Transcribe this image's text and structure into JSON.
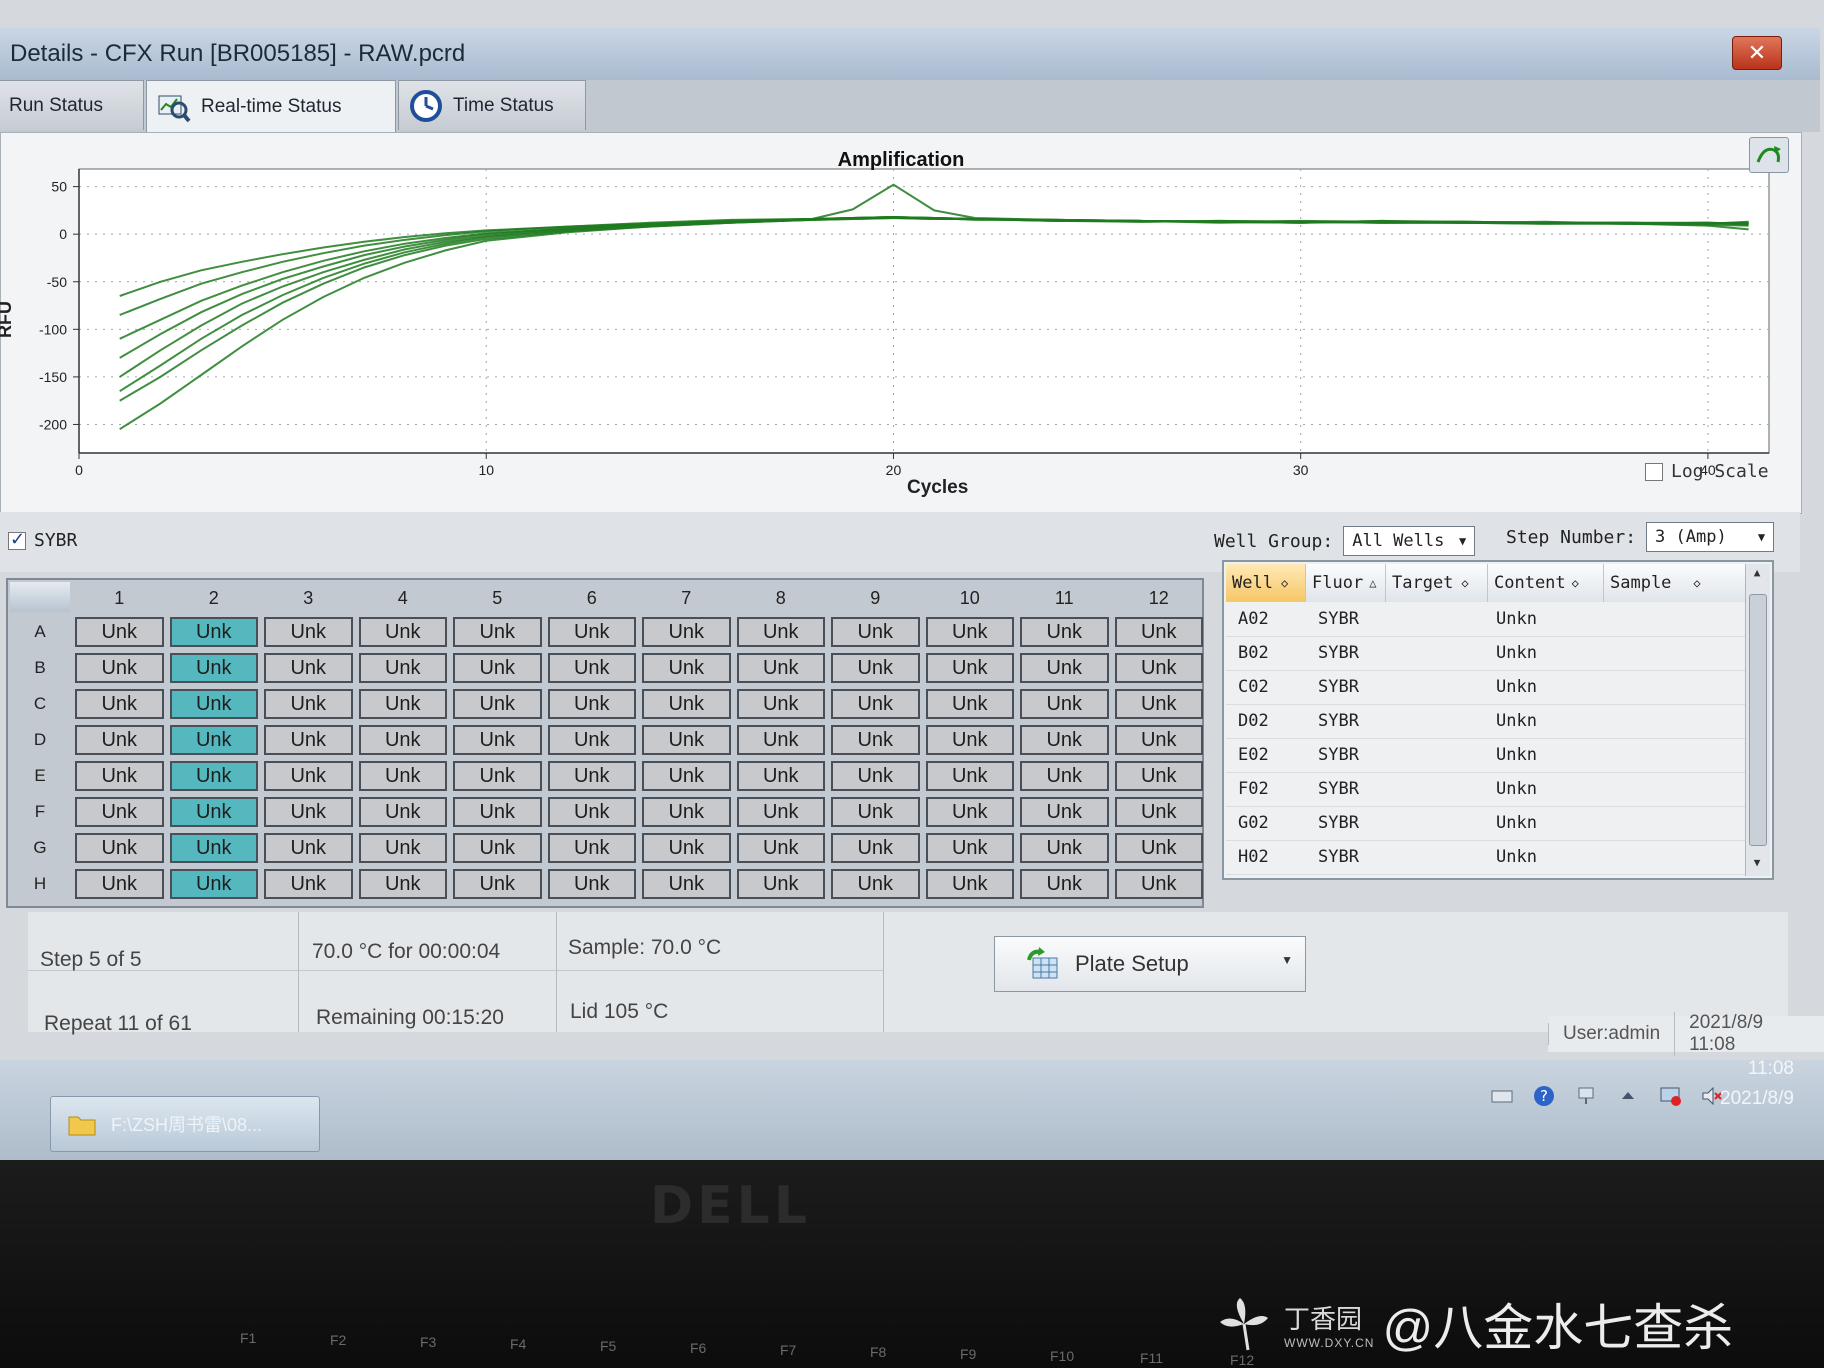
{
  "window": {
    "title": "Details - CFX Run [BR005185] - RAW.pcrd",
    "close_label": "✕"
  },
  "tabs": [
    {
      "label": "Run Status",
      "active": false
    },
    {
      "label": "Real-time Status",
      "active": true
    },
    {
      "label": "Time Status",
      "active": false
    }
  ],
  "chart_data": {
    "type": "line",
    "title": "Amplification",
    "xlabel": "Cycles",
    "ylabel": "RFU",
    "xlim": [
      0,
      41.5
    ],
    "ylim": [
      -230,
      58
    ],
    "xticks": [
      0,
      10,
      20,
      30,
      40
    ],
    "yticks": [
      50,
      0,
      -50,
      -100,
      -150,
      -200
    ],
    "grid": true,
    "log_scale": false,
    "line_color": "#1f7a1f",
    "x": [
      1,
      2,
      3,
      4,
      5,
      6,
      7,
      8,
      9,
      10,
      12,
      14,
      16,
      18,
      19,
      20,
      21,
      22,
      24,
      26,
      28,
      30,
      32,
      34,
      36,
      38,
      40,
      41
    ],
    "series": [
      {
        "values": [
          -65,
          -50,
          -38,
          -29,
          -21,
          -14,
          -8,
          -3,
          1,
          4,
          8,
          12,
          15,
          16,
          17,
          18,
          17,
          16,
          15,
          14,
          13,
          14,
          13,
          12,
          12,
          12,
          11,
          12
        ]
      },
      {
        "values": [
          -85,
          -68,
          -52,
          -40,
          -29,
          -20,
          -12,
          -6,
          -1,
          3,
          8,
          11,
          14,
          16,
          17,
          18,
          17,
          16,
          14,
          14,
          13,
          12,
          14,
          13,
          12,
          11,
          12,
          11
        ]
      },
      {
        "values": [
          -110,
          -90,
          -70,
          -54,
          -40,
          -28,
          -18,
          -10,
          -4,
          1,
          6,
          11,
          14,
          16,
          17,
          17,
          16,
          16,
          15,
          13,
          14,
          13,
          12,
          13,
          12,
          12,
          11,
          13
        ]
      },
      {
        "values": [
          -130,
          -105,
          -82,
          -63,
          -47,
          -34,
          -22,
          -13,
          -6,
          0,
          6,
          10,
          13,
          15,
          17,
          18,
          17,
          16,
          15,
          14,
          12,
          13,
          13,
          12,
          13,
          11,
          12,
          10
        ]
      },
      {
        "values": [
          -150,
          -122,
          -96,
          -73,
          -55,
          -40,
          -27,
          -16,
          -8,
          -2,
          5,
          10,
          13,
          16,
          17,
          18,
          17,
          15,
          15,
          14,
          13,
          12,
          14,
          12,
          12,
          12,
          11,
          12
        ]
      },
      {
        "values": [
          -165,
          -138,
          -110,
          -85,
          -64,
          -46,
          -31,
          -19,
          -10,
          -3,
          4,
          9,
          12,
          15,
          16,
          17,
          16,
          16,
          14,
          13,
          14,
          13,
          12,
          12,
          11,
          12,
          12,
          11
        ]
      },
      {
        "values": [
          -175,
          -150,
          -122,
          -96,
          -72,
          -52,
          -35,
          -22,
          -12,
          -5,
          3,
          8,
          12,
          15,
          16,
          17,
          17,
          16,
          14,
          14,
          13,
          12,
          13,
          13,
          12,
          11,
          10,
          9
        ]
      },
      {
        "values": [
          -205,
          -178,
          -148,
          -118,
          -90,
          -66,
          -46,
          -30,
          -17,
          -7,
          2,
          8,
          12,
          16,
          26,
          52,
          25,
          17,
          15,
          14,
          13,
          13,
          12,
          12,
          11,
          11,
          9,
          5
        ]
      }
    ]
  },
  "log_scale_label": "Log Scale",
  "sybr_label": "SYBR",
  "well_group": {
    "label": "Well Group:",
    "value": "All Wells"
  },
  "step_number": {
    "label": "Step Number:",
    "value": "3 (Amp)"
  },
  "plate": {
    "columns": [
      "1",
      "2",
      "3",
      "4",
      "5",
      "6",
      "7",
      "8",
      "9",
      "10",
      "11",
      "12"
    ],
    "rows": [
      "A",
      "B",
      "C",
      "D",
      "E",
      "F",
      "G",
      "H"
    ],
    "cell_label": "Unk",
    "selected_column": "2",
    "selected_color": "#55b8bf"
  },
  "well_table": {
    "headers": [
      "Well",
      "Fluor",
      "Target",
      "Content",
      "Sample"
    ],
    "rows": [
      {
        "well": "A02",
        "fluor": "SYBR",
        "target": "",
        "content": "Unkn",
        "sample": ""
      },
      {
        "well": "B02",
        "fluor": "SYBR",
        "target": "",
        "content": "Unkn",
        "sample": ""
      },
      {
        "well": "C02",
        "fluor": "SYBR",
        "target": "",
        "content": "Unkn",
        "sample": ""
      },
      {
        "well": "D02",
        "fluor": "SYBR",
        "target": "",
        "content": "Unkn",
        "sample": ""
      },
      {
        "well": "E02",
        "fluor": "SYBR",
        "target": "",
        "content": "Unkn",
        "sample": ""
      },
      {
        "well": "F02",
        "fluor": "SYBR",
        "target": "",
        "content": "Unkn",
        "sample": ""
      },
      {
        "well": "G02",
        "fluor": "SYBR",
        "target": "",
        "content": "Unkn",
        "sample": ""
      },
      {
        "well": "H02",
        "fluor": "SYBR",
        "target": "",
        "content": "Unkn",
        "sample": ""
      }
    ]
  },
  "status": {
    "step": "Step 5 of 5",
    "repeat": "Repeat 11 of 61",
    "hold": "70.0 °C for 00:00:04",
    "remaining": "Remaining 00:15:20",
    "sample_temp": "Sample: 70.0 °C",
    "lid_temp": "Lid 105 °C"
  },
  "plate_setup_label": "Plate Setup",
  "user": {
    "user": "User:admin",
    "datetime": "2021/8/9 11:08"
  },
  "taskbar": {
    "item_label": "F:\\ZSH周书雷\\08...",
    "clock_time": "11:08",
    "clock_date": "2021/8/9"
  },
  "bezel": {
    "brand": "DELL",
    "fkeys": [
      "F1",
      "F2",
      "F3",
      "F4",
      "F5",
      "F6",
      "F7",
      "F8",
      "F9",
      "F10",
      "F11",
      "F12"
    ]
  },
  "watermark": {
    "site": "丁香园",
    "url": "WWW.DXY.CN",
    "handle": "@八金水七查杀"
  }
}
